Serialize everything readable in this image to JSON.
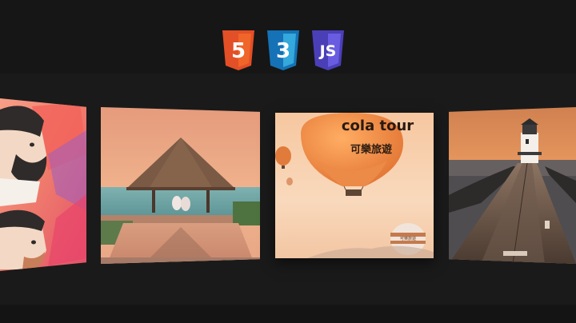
{
  "header": {
    "logos": [
      {
        "name": "html5",
        "glyph": "5",
        "color": "#e34f26"
      },
      {
        "name": "css3",
        "glyph": "3",
        "color": "#2965f1"
      },
      {
        "name": "javascript",
        "glyph": "JS",
        "color": "#5b4fd6"
      }
    ]
  },
  "carousel": {
    "balloon_text_latin": "cola tour",
    "balloon_text_cjk": "可樂旅遊",
    "balloon_small_text": "可樂旅遊",
    "items": [
      {
        "subject": "illustrated faces"
      },
      {
        "subject": "thatched hut over pool at sunset"
      },
      {
        "subject": "hot air balloons"
      },
      {
        "subject": "lighthouse at end of pier"
      }
    ]
  }
}
